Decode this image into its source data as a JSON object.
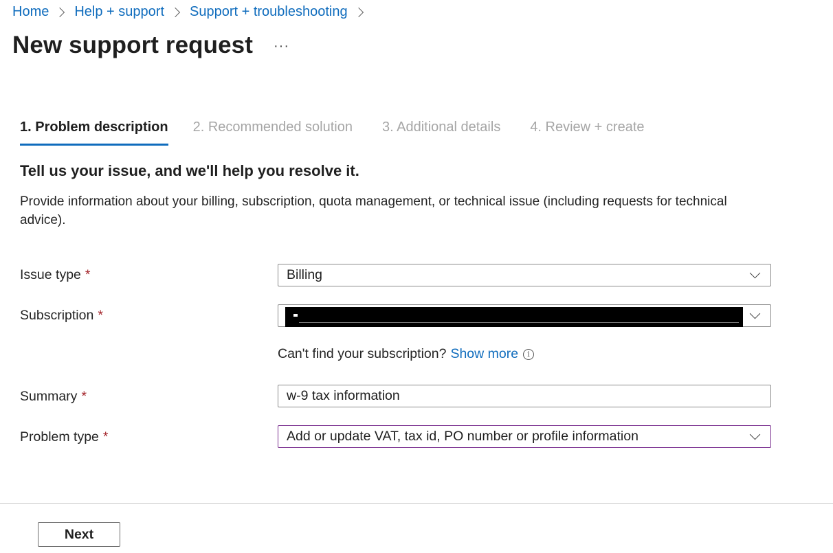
{
  "breadcrumb": [
    {
      "label": "Home"
    },
    {
      "label": "Help + support"
    },
    {
      "label": "Support + troubleshooting"
    }
  ],
  "page": {
    "title": "New support request",
    "more_label": "···"
  },
  "tabs": [
    {
      "label": "1. Problem description",
      "active": true
    },
    {
      "label": "2. Recommended solution",
      "active": false
    },
    {
      "label": "3. Additional details",
      "active": false
    },
    {
      "label": "4. Review + create",
      "active": false
    }
  ],
  "form": {
    "heading": "Tell us your issue, and we'll help you resolve it.",
    "description": "Provide information about your billing, subscription, quota management, or technical issue (including requests for technical advice).",
    "required_marker": "*",
    "issue_type": {
      "label": "Issue type",
      "value": "Billing"
    },
    "subscription": {
      "label": "Subscription",
      "value_redacted": true
    },
    "subscription_hint": {
      "text": "Can't find your subscription?",
      "link": "Show more",
      "icon": "info-icon"
    },
    "summary": {
      "label": "Summary",
      "value": "w-9 tax information"
    },
    "problem_type": {
      "label": "Problem type",
      "value": "Add or update VAT, tax id, PO number or profile information"
    }
  },
  "footer": {
    "next_label": "Next"
  },
  "colors": {
    "link": "#0f6cbd",
    "active_tab_underline": "#0f6cbd",
    "required": "#a4262c",
    "focused_border": "#7a2f8f"
  }
}
